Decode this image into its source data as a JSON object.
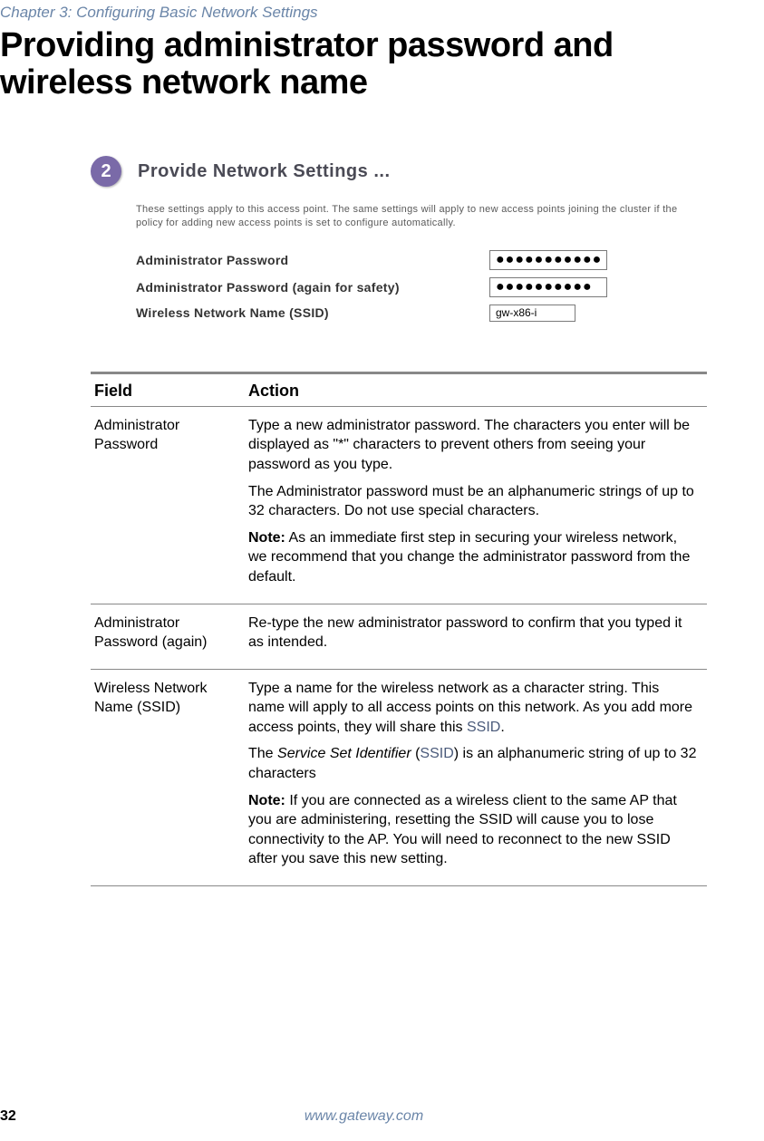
{
  "chapter": "Chapter 3: Configuring Basic Network Settings",
  "title": "Providing administrator password and wireless network name",
  "step": {
    "number": "2",
    "heading": "Provide Network Settings ...",
    "description": "These settings apply to this access point. The same settings will apply to new access points joining the cluster if the policy for adding new access points is set to configure automatically."
  },
  "form": {
    "rows": [
      {
        "label": "Administrator Password",
        "value": "●●●●●●●●●●●",
        "kind": "password"
      },
      {
        "label": "Administrator Password (again for safety)",
        "value": "●●●●●●●●●●",
        "kind": "password"
      },
      {
        "label": "Wireless Network Name (SSID)",
        "value": "gw-x86-i",
        "kind": "text"
      }
    ]
  },
  "table": {
    "head": {
      "col1": "Field",
      "col2": "Action"
    },
    "rows": [
      {
        "field": "Administrator Password",
        "p1": "Type a new administrator password. The characters you enter will be displayed as \"*\" characters to prevent others from seeing your password as you type.",
        "p2": "The Administrator password must be an alphanumeric strings of up to 32 characters. Do not use special characters.",
        "note_label": "Note:",
        "note": " As an immediate first step in securing your wireless network, we recommend that you change the administrator password from the default."
      },
      {
        "field": "Administrator Password (again)",
        "p1": "Re-type the new administrator password to confirm that you typed it as intended."
      },
      {
        "field": "Wireless Network Name (SSID)",
        "p1a": "Type a name for the wireless network as a character string. This name will apply to all access points on this network. As you add more access points, they will share this ",
        "p1link": "SSID",
        "p1b": ".",
        "p2a": "The ",
        "p2i": "Service Set Identifier",
        "p2b": " (",
        "p2link": "SSID",
        "p2c": ") is an alphanumeric string of up to 32 characters",
        "note_label": "Note:",
        "note": " If you are connected as a wireless client to the same AP that you are administering, resetting the SSID will cause you to lose connectivity to the AP. You will need to reconnect to the new SSID after you save this new setting."
      }
    ]
  },
  "footer": {
    "page": "32",
    "site": "www.gateway.com"
  }
}
